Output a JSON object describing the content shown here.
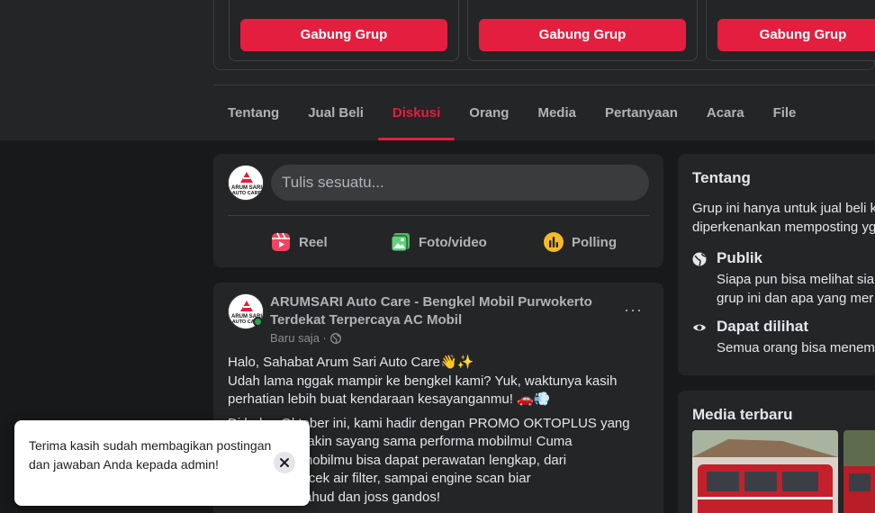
{
  "suggested_groups": {
    "join_labels": [
      "Gabung Grup",
      "Gabung Grup",
      "Gabung Grup"
    ]
  },
  "tabs": [
    {
      "label": "Tentang",
      "active": false
    },
    {
      "label": "Jual Beli",
      "active": false
    },
    {
      "label": "Diskusi",
      "active": true
    },
    {
      "label": "Orang",
      "active": false
    },
    {
      "label": "Media",
      "active": false
    },
    {
      "label": "Pertanyaan",
      "active": false
    },
    {
      "label": "Acara",
      "active": false
    },
    {
      "label": "File",
      "active": false
    }
  ],
  "composer": {
    "placeholder": "Tulis sesuatu...",
    "actions": [
      {
        "label": "Reel",
        "icon": "reel-icon",
        "color": "#f3425f"
      },
      {
        "label": "Foto/video",
        "icon": "photo-icon",
        "color": "#45bd62"
      },
      {
        "label": "Polling",
        "icon": "poll-icon",
        "color": "#f7b928"
      }
    ]
  },
  "avatar_text": {
    "line1": "ARUM SARI",
    "line2": "AUTO CARE"
  },
  "post": {
    "author": "ARUMSARI Auto Care - Bengkel Mobil Purwokerto Terdekat Terpercaya AC Mobil",
    "time": "Baru saja ·",
    "more": "···",
    "paragraph1_lines": [
      "Halo, Sahabat Arum Sari Auto Care👋✨",
      "Udah lama nggak mampir ke bengkel kami? Yuk, waktunya kasih",
      "perhatian lebih buat kendaraan kesayanganmu! 🚗💨"
    ],
    "paragraph2_lines": [
      "Di bulan Oktober ini, kami hadir dengan PROMO OKTOPLUS yang",
      "bikin kamu makin sayang sama performa mobilmu! Cuma",
      "Rp149.000, mobilmu bisa dapat perawatan lengkap, dari",
      "throttle body, cek air filter, sampai engine scan biar",
      "mobil tetap yahud dan joss gandos!"
    ]
  },
  "about": {
    "title": "Tentang",
    "desc_line1": "Grup ini hanya untuk jual beli k",
    "desc_line2": "diperkenankan memposting yg",
    "privacy_title": "Publik",
    "privacy_desc1": "Siapa pun bisa melihat siapa",
    "privacy_desc2": "grup ini dan apa yang mer",
    "visibility_title": "Dapat dilihat",
    "visibility_desc": "Semua orang bisa menemu"
  },
  "media": {
    "title": "Media terbaru"
  },
  "toast": {
    "message": "Terima kasih sudah membagikan postingan dan jawaban Anda kepada admin!",
    "close_icon": "close-icon"
  },
  "colors": {
    "accent": "#e41e3f",
    "background": "#18191a",
    "surface": "#242526"
  }
}
